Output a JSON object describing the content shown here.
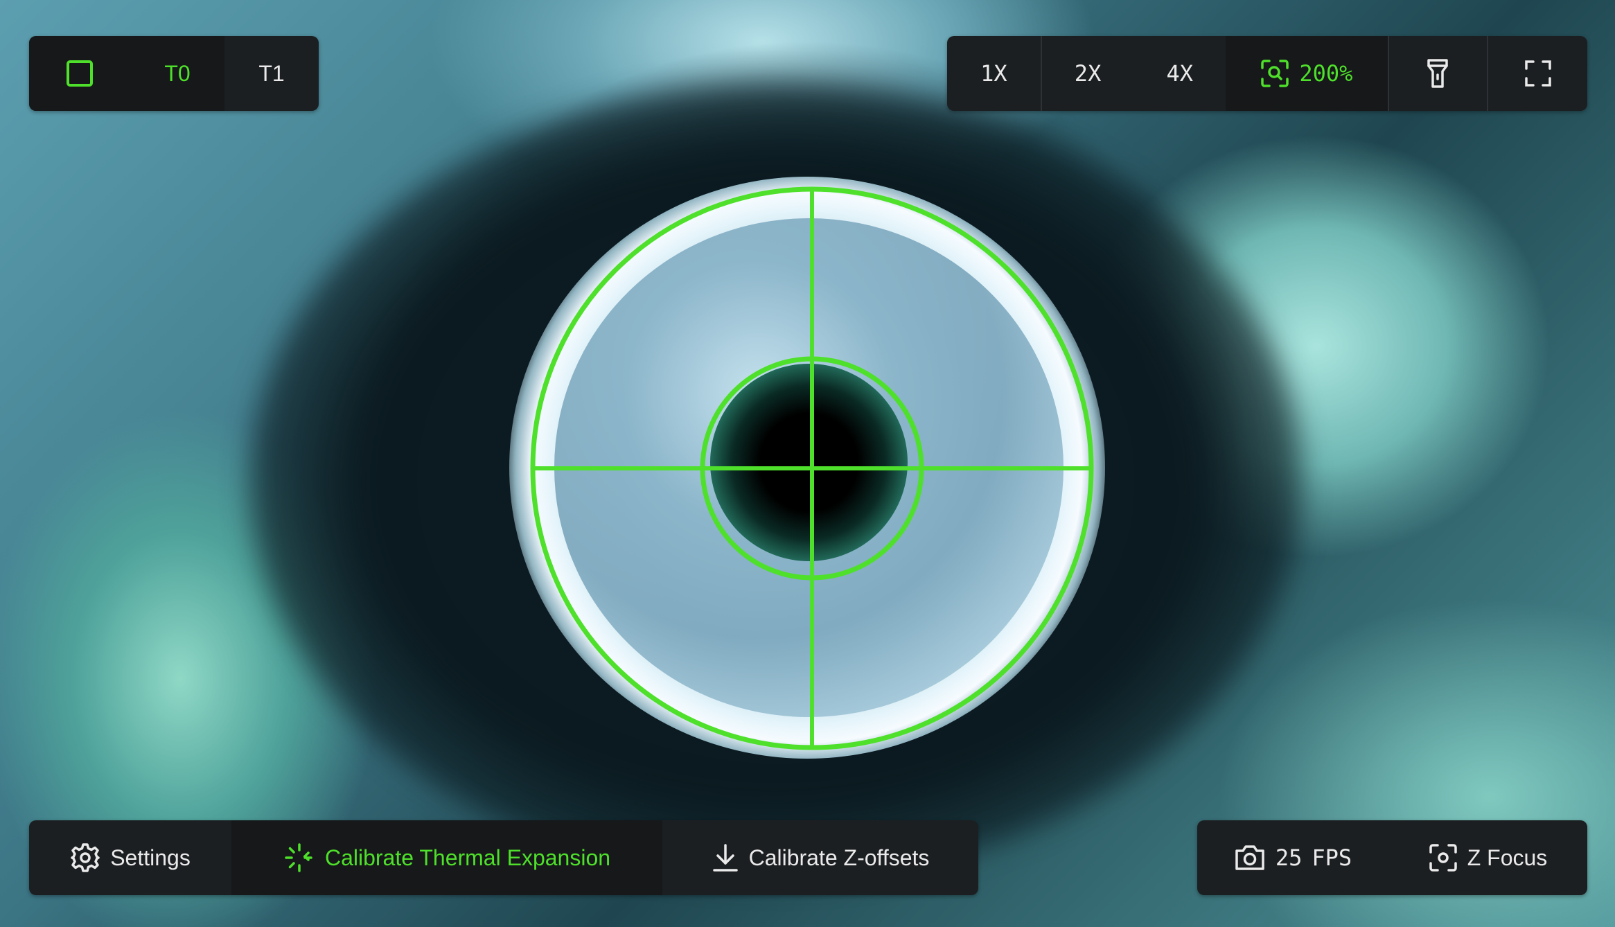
{
  "tools": {
    "t0": "T0",
    "t1": "T1"
  },
  "zoom": {
    "options": [
      "1X",
      "2X",
      "4X"
    ],
    "current_value": "200%"
  },
  "bottom_left": {
    "settings": "Settings",
    "calibrate_thermal": "Calibrate Thermal Expansion",
    "calibrate_z": "Calibrate Z-offsets"
  },
  "bottom_right": {
    "fps_value": "25",
    "fps_unit": "FPS",
    "z_focus": "Z Focus"
  },
  "icons": {
    "tool_selector": "square-icon",
    "zoom": "zoom-scan-icon",
    "light": "flashlight-icon",
    "fullscreen": "fullscreen-icon",
    "settings": "gear-icon",
    "calibrate_thermal": "sparkle-loader-icon",
    "calibrate_z": "download-arrow-icon",
    "camera": "camera-icon",
    "focus": "focus-icon"
  },
  "colors": {
    "accent": "#4ee02a",
    "panel": "#1c1f22",
    "panel_active": "#16181a",
    "text": "#eaeaea"
  }
}
